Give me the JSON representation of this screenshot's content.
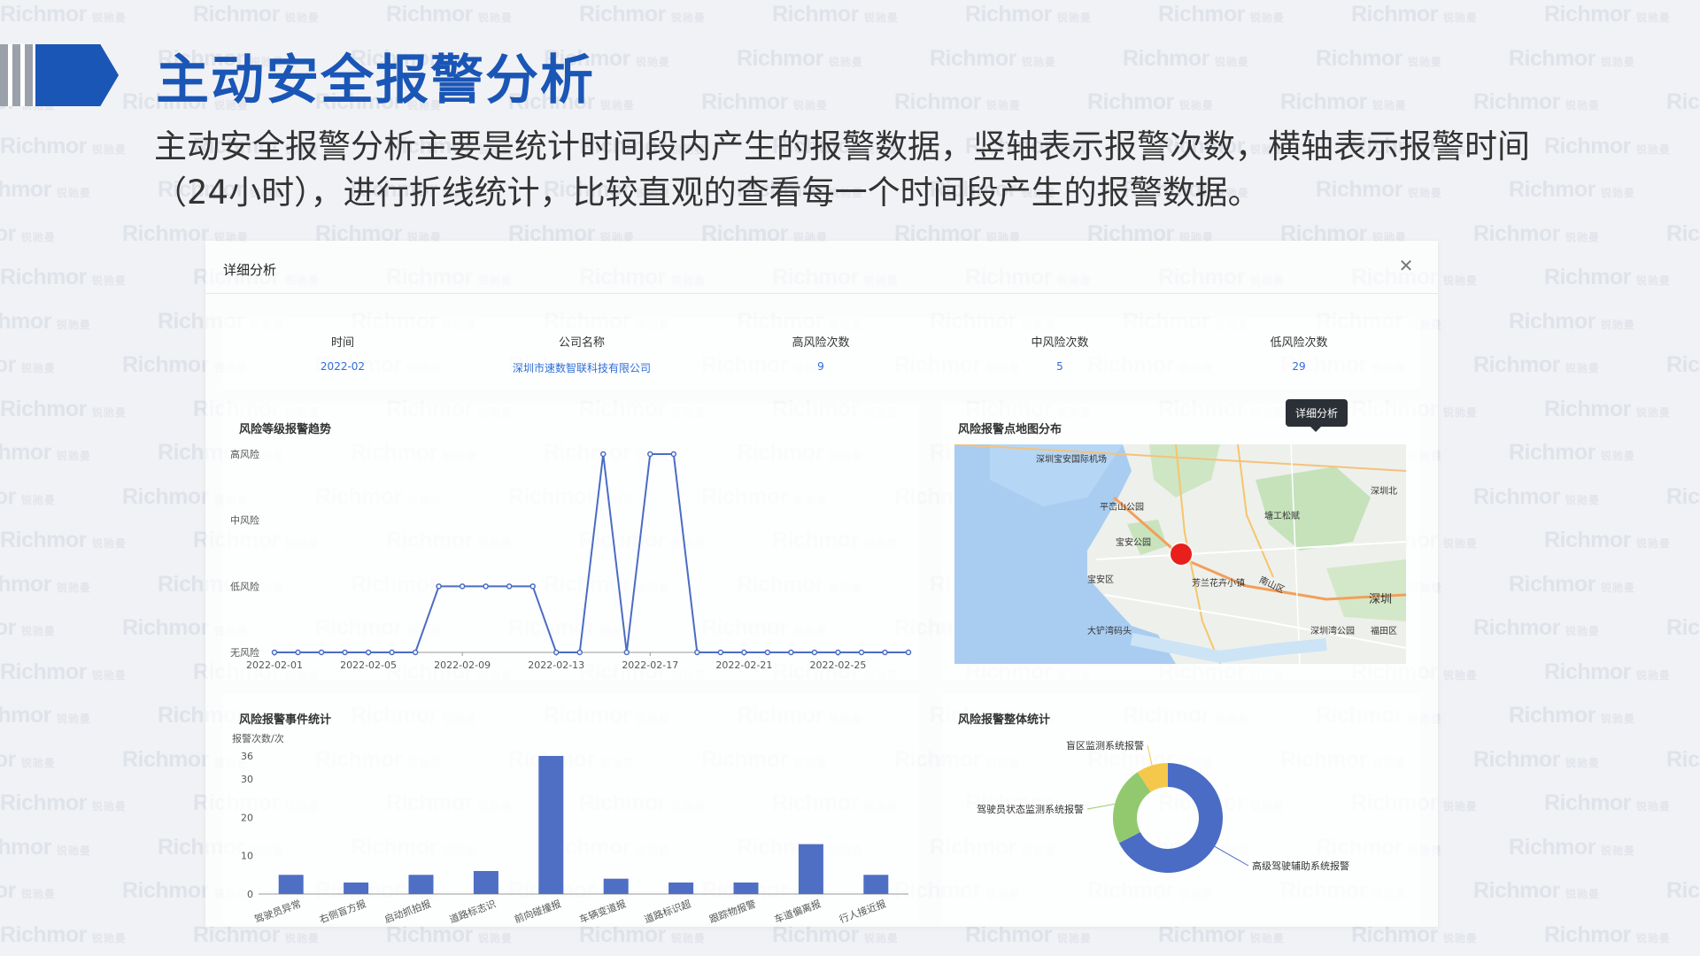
{
  "watermark": {
    "brand": "Richmor",
    "suffix": "锐驰曼"
  },
  "slide": {
    "title": "主动安全报警分析",
    "description_line1": "主动安全报警分析主要是统计时间段内产生的报警数据，竖轴表示报警次数，横轴表示报警时间",
    "description_line2": "（24小时），进行折线统计，比较直观的查看每一个时间段产生的报警数据。"
  },
  "modal": {
    "title": "详细分析",
    "close_icon": "close-icon",
    "summary": [
      {
        "label": "时间",
        "value": "2022-02"
      },
      {
        "label": "公司名称",
        "value": "深圳市速数智联科技有限公司"
      },
      {
        "label": "高风险次数",
        "value": "9"
      },
      {
        "label": "中风险次数",
        "value": "5"
      },
      {
        "label": "低风险次数",
        "value": "29"
      }
    ]
  },
  "tooltip": {
    "text": "详细分析"
  },
  "map_panel": {
    "title": "风险报警点地图分布",
    "labels": [
      "深圳宝安国际机场",
      "平峦山公园",
      "宝安公园",
      "宝安区",
      "芳兰花卉小镇",
      "大铲湾码头",
      "南山区",
      "深圳湾公园",
      "福田区",
      "深圳北",
      "塘工松赋",
      "深圳"
    ],
    "marker_icon": "map-pin-icon"
  },
  "chart_data": [
    {
      "type": "line",
      "title": "风险等级报警趋势",
      "y_categories": [
        "无风险",
        "低风险",
        "中风险",
        "高风险"
      ],
      "x_ticks": [
        "2022-02-01",
        "2022-02-05",
        "2022-02-09",
        "2022-02-13",
        "2022-02-17",
        "2022-02-21",
        "2022-02-25"
      ],
      "x_start": "2022-02-01",
      "x_end": "2022-02-28",
      "series": [
        {
          "x": [
            "2022-02-01",
            "2022-02-02",
            "2022-02-03",
            "2022-02-04",
            "2022-02-05",
            "2022-02-06",
            "2022-02-07",
            "2022-02-08",
            "2022-02-09",
            "2022-02-10",
            "2022-02-11",
            "2022-02-12",
            "2022-02-13",
            "2022-02-14",
            "2022-02-15",
            "2022-02-16",
            "2022-02-17",
            "2022-02-18",
            "2022-02-19",
            "2022-02-20",
            "2022-02-21",
            "2022-02-22",
            "2022-02-23",
            "2022-02-24",
            "2022-02-25",
            "2022-02-26",
            "2022-02-27",
            "2022-02-28"
          ],
          "values": [
            0,
            0,
            0,
            0,
            0,
            0,
            0,
            1,
            1,
            1,
            1,
            1,
            0,
            0,
            3,
            0,
            3,
            3,
            0,
            0,
            0,
            0,
            0,
            0,
            0,
            0,
            0,
            0
          ]
        }
      ],
      "color": "#4a6cc4"
    },
    {
      "type": "bar",
      "title": "风险报警事件统计",
      "ylabel": "报警次数/次",
      "ylim": [
        0,
        36
      ],
      "y_ticks": [
        0,
        10,
        20,
        30,
        36
      ],
      "categories": [
        "驾驶员异常",
        "右侧盲方报",
        "启动抓拍报",
        "道路标志识",
        "前向碰撞报",
        "车辆变道报",
        "道路标识超",
        "跟踪物报警",
        "车道偏离报",
        "行人接近报"
      ],
      "values": [
        5,
        3,
        5,
        6,
        36,
        4,
        3,
        3,
        13,
        5
      ],
      "color": "#4f6fc4"
    },
    {
      "type": "pie",
      "title": "风险报警整体统计",
      "labels": [
        "高级驾驶辅助系统报警",
        "驾驶员状态监测系统报警",
        "盲区监测系统报警"
      ],
      "values": [
        29,
        10,
        4
      ],
      "colors": [
        "#4a6cc4",
        "#92c96e",
        "#f5c84b"
      ]
    }
  ]
}
